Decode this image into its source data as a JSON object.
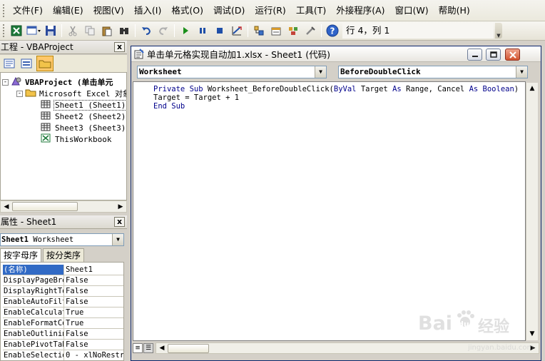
{
  "menu": {
    "items": [
      "文件(F)",
      "编辑(E)",
      "视图(V)",
      "插入(I)",
      "格式(O)",
      "调试(D)",
      "运行(R)",
      "工具(T)",
      "外接程序(A)",
      "窗口(W)",
      "帮助(H)"
    ]
  },
  "toolbar": {
    "cursor_position": "行 4，列 1",
    "icons": [
      "excel-icon",
      "insert-module-icon",
      "save-icon",
      "cut-icon",
      "copy-icon",
      "paste-icon",
      "find-icon",
      "undo-icon",
      "redo-icon",
      "run-icon",
      "break-icon",
      "reset-icon",
      "design-mode-icon",
      "project-explorer-icon",
      "properties-icon",
      "object-browser-icon",
      "toolbox-icon",
      "help-icon"
    ]
  },
  "project_pane": {
    "title": "工程 - VBAProject",
    "close": "x",
    "tree": [
      {
        "label": "VBAProject (单击单元",
        "level": 0,
        "bold": true,
        "icon": "vba-project-icon",
        "expander": "-"
      },
      {
        "label": "Microsoft Excel 对象",
        "level": 1,
        "bold": false,
        "icon": "folder-icon",
        "expander": "-"
      },
      {
        "label": "Sheet1 (Sheet1)",
        "level": 2,
        "bold": false,
        "icon": "sheet-icon",
        "selected": true
      },
      {
        "label": "Sheet2 (Sheet2)",
        "level": 2,
        "bold": false,
        "icon": "sheet-icon"
      },
      {
        "label": "Sheet3 (Sheet3)",
        "level": 2,
        "bold": false,
        "icon": "sheet-icon"
      },
      {
        "label": "ThisWorkbook",
        "level": 2,
        "bold": false,
        "icon": "workbook-icon"
      }
    ]
  },
  "properties_pane": {
    "title": "属性 - Sheet1",
    "close": "x",
    "object_combo_bold": "Sheet1",
    "object_combo_rest": " Worksheet",
    "tabs": [
      "按字母序",
      "按分类序"
    ],
    "rows": [
      {
        "name": "(名称)",
        "value": "Sheet1",
        "selected": true
      },
      {
        "name": "DisplayPageBre",
        "value": "False"
      },
      {
        "name": "DisplayRightTo",
        "value": "False"
      },
      {
        "name": "EnableAutoFilt",
        "value": "False"
      },
      {
        "name": "EnableCalculat",
        "value": "True"
      },
      {
        "name": "EnableFormatCo",
        "value": "True"
      },
      {
        "name": "EnableOutlinin",
        "value": "False"
      },
      {
        "name": "EnablePivotTab",
        "value": "False"
      },
      {
        "name": "EnableSelectio",
        "value": "0 - xlNoRestr"
      }
    ]
  },
  "code_window": {
    "title": "单击单元格实现自动加1.xlsx - Sheet1 (代码)",
    "object_combo": "Worksheet",
    "procedure_combo": "BeforeDoubleClick",
    "lines": [
      [
        {
          "t": "Private Sub ",
          "kw": true
        },
        {
          "t": "Worksheet_BeforeDoubleClick(",
          "kw": false
        },
        {
          "t": "ByVal ",
          "kw": true
        },
        {
          "t": "Target ",
          "kw": false
        },
        {
          "t": "As ",
          "kw": true
        },
        {
          "t": "Range, Cancel ",
          "kw": false
        },
        {
          "t": "As Boolean",
          "kw": true
        },
        {
          "t": ")",
          "kw": false
        }
      ],
      [
        {
          "t": "Target = Target + 1",
          "kw": false
        }
      ],
      [
        {
          "t": "End Sub",
          "kw": true
        }
      ]
    ]
  },
  "watermark": {
    "brand_bold": "Bai",
    "brand_paw": "du",
    "brand_cn": "经验",
    "url": "jingyan.baidu.com"
  },
  "colors": {
    "keyword": "#00008b",
    "selection": "#316ac5"
  }
}
